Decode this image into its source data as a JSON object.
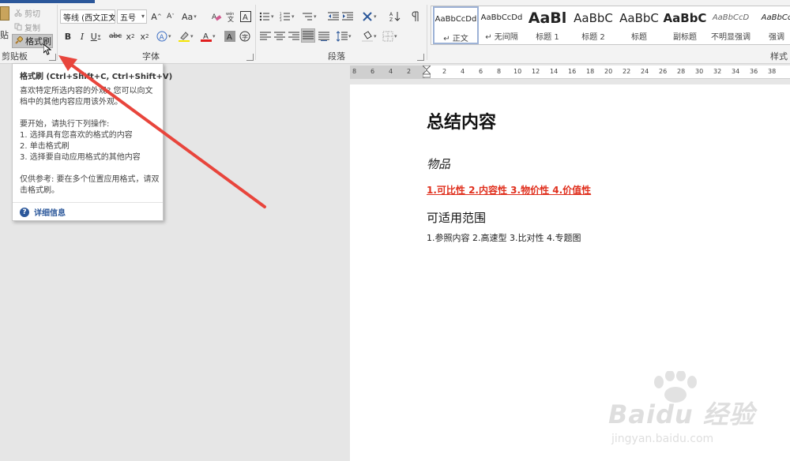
{
  "clipboard": {
    "paste_label": "贴",
    "cut_label": "剪切",
    "copy_label": "复制",
    "format_painter_label": "格式刷",
    "group_label": "剪贴板"
  },
  "font": {
    "font_name": "等线 (西文正文",
    "font_size": "五号",
    "grow": "A",
    "shrink": "A",
    "change_case": "Aa",
    "bold": "B",
    "italic": "I",
    "underline": "U",
    "strike": "abc",
    "subscript": "x",
    "superscript": "x",
    "group_label": "字体"
  },
  "paragraph": {
    "group_label": "段落"
  },
  "styles": {
    "group_label": "样式",
    "items": [
      {
        "sample": "AaBbCcDd",
        "name": "↵ 正文"
      },
      {
        "sample": "AaBbCcDd",
        "name": "↵ 无间隔"
      },
      {
        "sample": "AaBl",
        "name": "标题 1"
      },
      {
        "sample": "AaBbC",
        "name": "标题 2"
      },
      {
        "sample": "AaBbC",
        "name": "标题"
      },
      {
        "sample": "AaBbC",
        "name": "副标题"
      },
      {
        "sample": "AaBbCcD",
        "name": "不明显强调"
      },
      {
        "sample": "AaBbCc",
        "name": "强调"
      }
    ]
  },
  "tooltip": {
    "title": "格式刷 (Ctrl+Shift+C, Ctrl+Shift+V)",
    "p1": "喜欢特定所选内容的外观? 您可以向文档中的其他内容应用该外观。",
    "p2": "要开始，请执行下列操作:\n1. 选择具有您喜欢的格式的内容\n2. 单击格式刷\n3. 选择要自动应用格式的其他内容",
    "p3": "仅供参考: 要在多个位置应用格式，请双击格式刷。",
    "more": "详细信息"
  },
  "ruler": {
    "left_nums": [
      "8",
      "6",
      "4",
      "2"
    ],
    "right_nums": [
      "2",
      "4",
      "6",
      "8",
      "10",
      "12",
      "14",
      "16",
      "18",
      "20",
      "22",
      "24",
      "26",
      "28",
      "30",
      "32",
      "34",
      "36",
      "38"
    ]
  },
  "document": {
    "title": "总结内容",
    "subtitle": "物品",
    "red_line": "1.可比性    2.内容性   3.物价性   4.价值性",
    "heading3": "可适用范围",
    "line": "1.参照内容  2.高速型  3.比对性  4.专题图"
  },
  "watermark": {
    "brand": "Baidu 经验",
    "url": "jingyan.baidu.com"
  },
  "colors": {
    "accent": "#2b579a",
    "red_text": "#e0301e",
    "arrow": "#e8453c"
  }
}
